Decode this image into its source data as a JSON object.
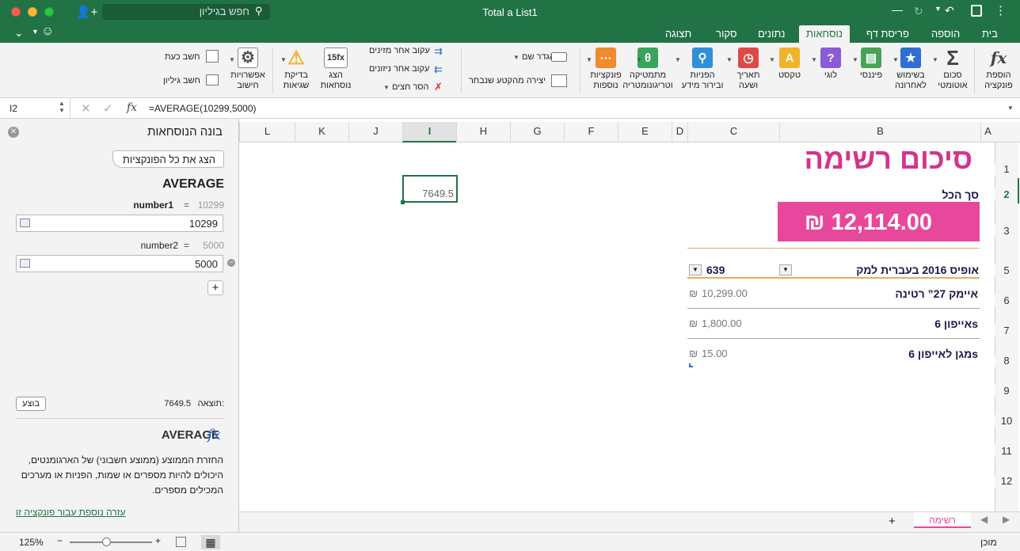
{
  "window": {
    "title": "Total a List1"
  },
  "search": {
    "placeholder": "חפש בגיליון"
  },
  "tabs": [
    "בית",
    "הוספה",
    "פריסת דף",
    "נוסחאות",
    "נתונים",
    "סקור",
    "תצוגה"
  ],
  "ribbon": {
    "insert_function": "הוספת\nפונקציה",
    "autosum": "סכום\nאוטומטי",
    "recent": "בשימוש\nלאחרונה",
    "financial": "פיננסי",
    "logical": "לוגי",
    "text": "טקסט",
    "datetime": "תאריך\nושעה",
    "lookup": "הפניות\nובירור מידע",
    "math": "מתמטיקה\nוטריגונומטריה",
    "more": "פונקציות\nנוספות",
    "define_name": "הגדר שם",
    "create_selection": "יצירה מהקטע שנבחר",
    "trace_precedents": "עקוב אחר מזינים",
    "trace_dependents": "עקוב אחר ניזונים",
    "remove_arrows": "הסר חצים",
    "show_formulas": "הצג\nנוסחאות",
    "error_checking": "בדיקת\nשגיאות",
    "calc_options": "אפשרויות\nחישוב",
    "calc_now": "חשב כעת",
    "calc_sheet": "חשב גיליון"
  },
  "formula_bar": {
    "name_box": "I2",
    "formula": "=AVERAGE(10299,5000)"
  },
  "pane": {
    "title": "בונה הנוסחאות",
    "show_all": "הצג את כל הפונקציות",
    "function_name": "AVERAGE",
    "arg1_label": "number1",
    "arg1_eq": "=",
    "arg1_preview": "10299",
    "arg1_value": "10299",
    "arg2_label": "number2",
    "arg2_eq": "=",
    "arg2_preview": "5000",
    "arg2_value": "5000",
    "add_arg": "+",
    "result_label": "תוצאה:",
    "result_value": "7649.5",
    "done_button": "בוצע",
    "help_title": "AVERAGE",
    "help_fx": "fx",
    "description": "החזרת הממוצע (ממוצע חשבוני) של הארגומנטים, היכולים להיות מספרים או שמות, הפניות או מערכים המכילים מספרים.",
    "more_help": "עזרה נוספת עבור פונקציה זו"
  },
  "columns": [
    "L",
    "K",
    "J",
    "I",
    "H",
    "G",
    "F",
    "E",
    "D",
    "C",
    "B",
    "A"
  ],
  "rows": [
    "1",
    "2",
    "3",
    "5",
    "6",
    "7",
    "8",
    "9",
    "10",
    "11",
    "12"
  ],
  "sheet": {
    "title": "סיכום רשימה",
    "total_label": "סך הכל",
    "total_value": "₪ 12,114.00",
    "header_item": "אופיס 2016 בעברית למק",
    "header_value": "639",
    "selected_cell": "7649.5",
    "items": [
      {
        "name": "איימק 27” רטינה",
        "price": "10,299.00",
        "currency": "₪"
      },
      {
        "name": "אייפון 6s",
        "price": "1,800.00",
        "currency": "₪"
      },
      {
        "name": "מגן לאייפון 6s",
        "price": "15.00",
        "currency": "₪"
      }
    ]
  },
  "sheet_tab": "רשימה",
  "status": {
    "zoom": "125%",
    "ready": "מוכן"
  },
  "colors": {
    "brand": "#217346",
    "pink": "#e8489b",
    "title_pink": "#d6338b",
    "navy": "#1b1a4a"
  }
}
